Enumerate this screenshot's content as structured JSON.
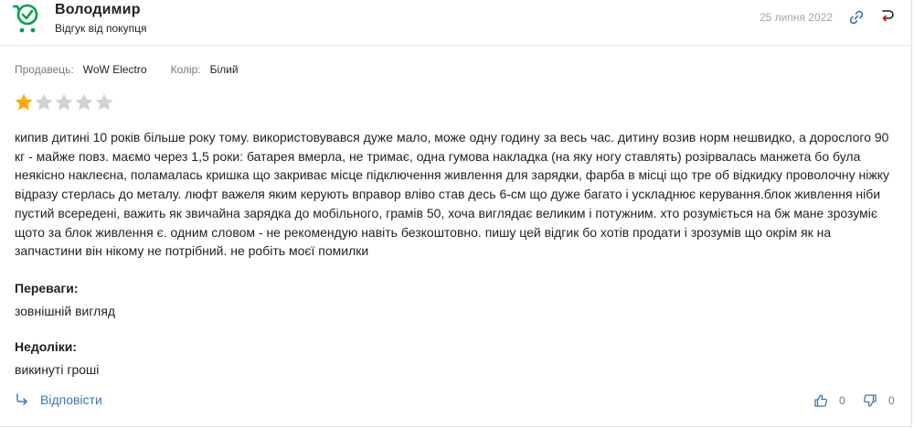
{
  "author": {
    "name": "Володимир",
    "subtitle": "Відгук від покупця",
    "avatar_icon": "cart-checkmark-icon",
    "avatar_color": "#00a046"
  },
  "date": "25 липня 2022",
  "header_icons": [
    "link-icon",
    "reply-arrow-icon"
  ],
  "meta": {
    "seller_label": "Продавець:",
    "seller_value": "WoW Electro",
    "color_label": "Колір:",
    "color_value": "Білий"
  },
  "rating": {
    "value": 1,
    "max": 5,
    "filled_color": "#ffa900",
    "empty_color": "#d2d2d2"
  },
  "review_text": "кипив дитині 10 років більше року тому. використовувався дуже мало, може одну годину за весь час. дитину возив норм нешвидко, а дорослого 90 кг - майже повз. маємо через 1,5 роки: батарея вмерла, не тримає, одна гумова накладка (на яку ногу ставлять) розірвалась манжета бо була неякісно наклеєна, поламалась кришка що закриває місце підключення живлення для зарядки, фарба в місці що тре об відкидку проволочну ніжку відразу стерлась до металу. люфт важеля яким керують вправор вліво став десь 6-см що дуже багато і ускладнює керування.блок живлення ніби пустий всередені, важить як звичайна зарядка до мобільного, грамів 50, хоча виглядає великим і потужним. хто розуміється на бж мане зрозуміє щото за блок живлення є. одним словом - не рекомендую навіть безкоштовно. пишу цей відгик бо хотів продати і зрозумів що окрім як на запчастини він нікому не потрібний. не робіть моєї помилки",
  "pros": {
    "title": "Переваги:",
    "text": "зовнішній вигляд"
  },
  "cons": {
    "title": "Недоліки:",
    "text": "викинуті гроші"
  },
  "footer": {
    "reply_label": "Відповісти",
    "likes": "0",
    "dislikes": "0",
    "link_color": "#3e77aa"
  }
}
